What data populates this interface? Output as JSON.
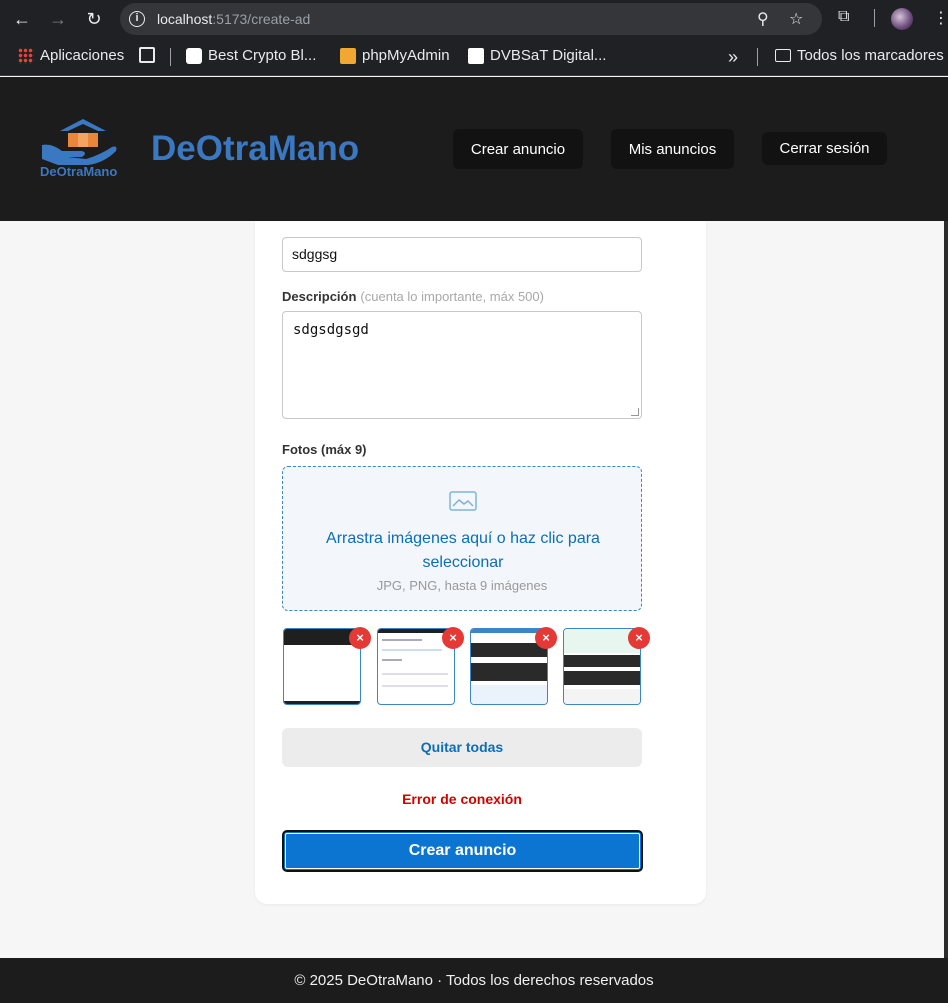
{
  "browser": {
    "url_host": "localhost",
    "url_path": ":5173/create-ad",
    "bookmarks": [
      "Aplicaciones",
      "Best Crypto Bl...",
      "phpMyAdmin",
      "DVBSaT Digital...",
      "Todos los marcadores"
    ]
  },
  "header": {
    "brand": "DeOtraMano",
    "logo_text": "DeOtraMano",
    "nav": [
      "Crear anuncio",
      "Mis anuncios",
      "Cerrar sesión"
    ]
  },
  "form": {
    "title_value": "sdggsg",
    "description_label": "Descripción",
    "description_hint": "(cuenta lo importante, máx 500)",
    "description_value": "sdgsdgsgd",
    "photos_label": "Fotos (máx 9)",
    "dropzone_text": "Arrastra imágenes aquí o haz clic para seleccionar",
    "dropzone_subtext": "JPG, PNG, hasta 9 imágenes",
    "remove_symbol": "×",
    "clear_all_label": "Quitar todas",
    "error_message": "Error de conexión",
    "submit_label": "Crear anuncio"
  },
  "footer": {
    "text": "© 2025 DeOtraMano · Todos los derechos reservados"
  },
  "colors": {
    "brand_blue": "#3b78c2",
    "primary_button": "#0b75d1",
    "error": "#d40000",
    "remove_badge": "#e53935"
  }
}
